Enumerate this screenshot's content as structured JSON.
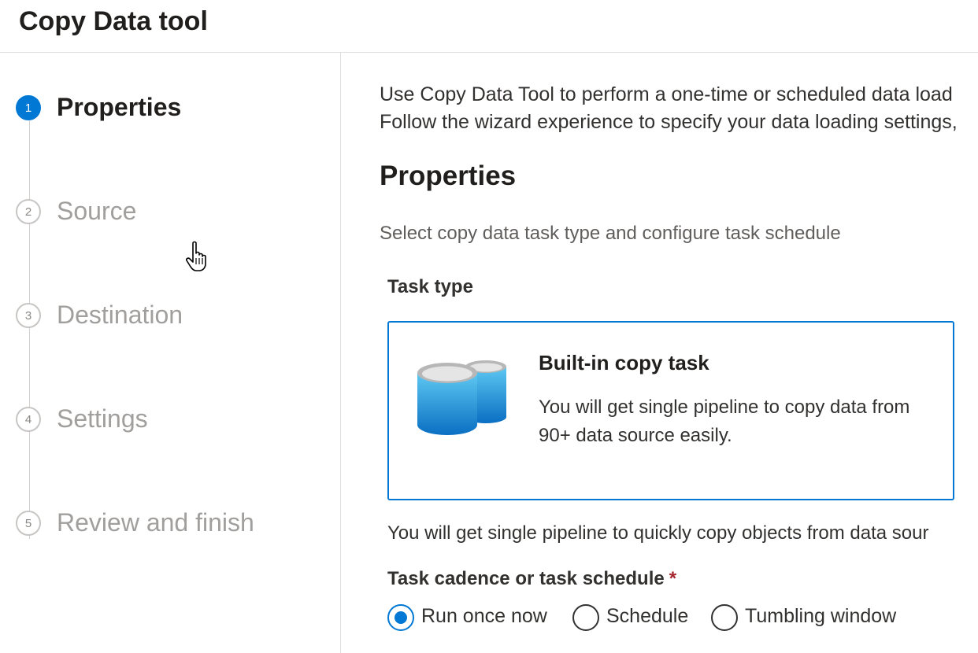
{
  "header": {
    "title": "Copy Data tool"
  },
  "steps": [
    {
      "number": "1",
      "label": "Properties",
      "active": true
    },
    {
      "number": "2",
      "label": "Source",
      "active": false
    },
    {
      "number": "3",
      "label": "Destination",
      "active": false
    },
    {
      "number": "4",
      "label": "Settings",
      "active": false
    },
    {
      "number": "5",
      "label": "Review and finish",
      "active": false
    }
  ],
  "main": {
    "intro_line1": "Use Copy Data Tool to perform a one-time or scheduled data load",
    "intro_line2": "Follow the wizard experience to specify your data loading settings,",
    "section_title": "Properties",
    "section_subtitle": "Select copy data task type and configure task schedule",
    "task_type_label": "Task type",
    "task_card": {
      "title": "Built-in copy task",
      "description": "You will get single pipeline to copy data from 90+ data source easily.",
      "icon": "database-icon"
    },
    "task_note": "You will get single pipeline to quickly copy objects from data sour",
    "cadence_label": "Task cadence or task schedule",
    "cadence_required_mark": "*",
    "cadence_options": [
      {
        "label": "Run once now",
        "selected": true
      },
      {
        "label": "Schedule",
        "selected": false
      },
      {
        "label": "Tumbling window",
        "selected": false
      }
    ]
  },
  "colors": {
    "accent": "#0078d4",
    "required": "#a4262c",
    "inactive_step": "#a19f9d"
  }
}
